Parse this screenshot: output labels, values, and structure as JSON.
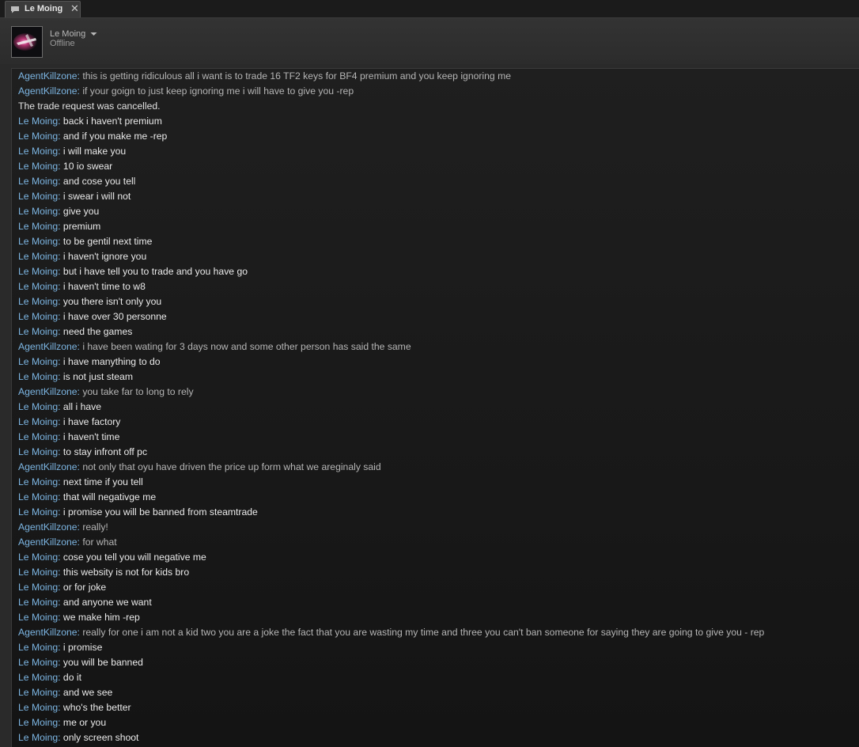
{
  "tab": {
    "icon": "chat-bubble-icon",
    "title": "Le Moing",
    "close": "✕"
  },
  "header": {
    "avatar_icon": "avatar",
    "name": "Le Moing",
    "dropdown_icon": "caret-down-icon",
    "status": "Offline"
  },
  "colors": {
    "sender": "#7cb5e2",
    "self_text": "#b5b5b5",
    "friend_text": "#eaeaea",
    "background": "#1a1a1a"
  },
  "messages": [
    {
      "sender": "AgentKillzone",
      "text": "this is getting ridiculous all i want is to trade 16 TF2 keys for BF4 premium and you keep ignoring me"
    },
    {
      "sender": "AgentKillzone",
      "text": "if your goign to just keep ignoring me i will have to give you -rep"
    },
    {
      "sender": "",
      "text": "The trade request was cancelled."
    },
    {
      "sender": "Le Moing",
      "text": "back i haven't premium"
    },
    {
      "sender": "Le Moing",
      "text": "and if you make me -rep"
    },
    {
      "sender": "Le Moing",
      "text": "i will make you"
    },
    {
      "sender": "Le Moing",
      "text": "10 io swear"
    },
    {
      "sender": "Le Moing",
      "text": "and cose you tell"
    },
    {
      "sender": "Le Moing",
      "text": "i swear i will not"
    },
    {
      "sender": "Le Moing",
      "text": "give you"
    },
    {
      "sender": "Le Moing",
      "text": "premium"
    },
    {
      "sender": "Le Moing",
      "text": "to be gentil next time"
    },
    {
      "sender": "Le Moing",
      "text": "i haven't ignore you"
    },
    {
      "sender": "Le Moing",
      "text": "but i have tell you to trade and you have go"
    },
    {
      "sender": "Le Moing",
      "text": "i haven't time to w8"
    },
    {
      "sender": "Le Moing",
      "text": "you there isn't only you"
    },
    {
      "sender": "Le Moing",
      "text": "i have over 30 personne"
    },
    {
      "sender": "Le Moing",
      "text": "need the games"
    },
    {
      "sender": "AgentKillzone",
      "text": "i have been wating for 3 days now and some other person has said the same"
    },
    {
      "sender": "Le Moing",
      "text": "i have manything to do"
    },
    {
      "sender": "Le Moing",
      "text": "is not just steam"
    },
    {
      "sender": "AgentKillzone",
      "text": "you take far to long to rely"
    },
    {
      "sender": "Le Moing",
      "text": "all i have"
    },
    {
      "sender": "Le Moing",
      "text": "i have factory"
    },
    {
      "sender": "Le Moing",
      "text": "i haven't time"
    },
    {
      "sender": "Le Moing",
      "text": "to stay infront off pc"
    },
    {
      "sender": "AgentKillzone",
      "text": "not only that oyu have driven the price up form what we areginaly said"
    },
    {
      "sender": "Le Moing",
      "text": "next time if you tell"
    },
    {
      "sender": "Le Moing",
      "text": "that will negativge me"
    },
    {
      "sender": "Le Moing",
      "text": "i promise you will be banned from steamtrade"
    },
    {
      "sender": "AgentKillzone",
      "text": "really!"
    },
    {
      "sender": "AgentKillzone",
      "text": "for what"
    },
    {
      "sender": "Le Moing",
      "text": "cose you tell you will negative me"
    },
    {
      "sender": "Le Moing",
      "text": "this websity is not for kids bro"
    },
    {
      "sender": "Le Moing",
      "text": "or for joke"
    },
    {
      "sender": "Le Moing",
      "text": "and anyone we want"
    },
    {
      "sender": "Le Moing",
      "text": "we make him -rep"
    },
    {
      "sender": "AgentKillzone",
      "text": "really for one i am not a kid two you are a joke the fact that you are wasting my time and three you can't ban someone for saying they are going to give you - rep"
    },
    {
      "sender": "Le Moing",
      "text": "i promise"
    },
    {
      "sender": "Le Moing",
      "text": "you will be banned"
    },
    {
      "sender": "Le Moing",
      "text": "do it"
    },
    {
      "sender": "Le Moing",
      "text": "and we see"
    },
    {
      "sender": "Le Moing",
      "text": "who's the better"
    },
    {
      "sender": "Le Moing",
      "text": "me or you"
    },
    {
      "sender": "Le Moing",
      "text": "only screen shoot"
    }
  ]
}
